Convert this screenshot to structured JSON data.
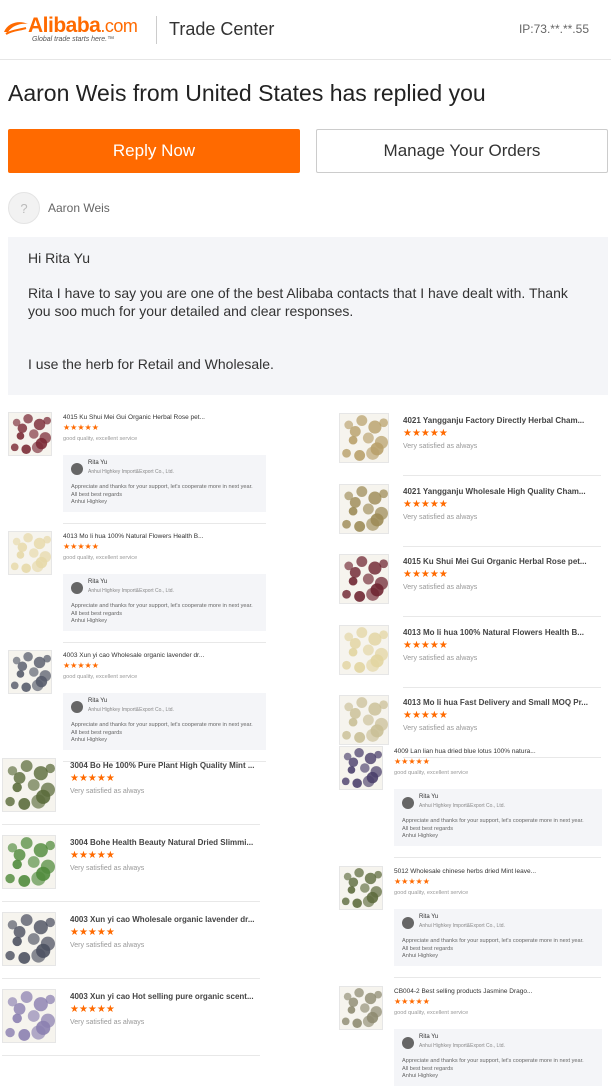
{
  "header": {
    "logo_word": "Alibaba",
    "logo_com": ".com",
    "logo_tagline": "Global trade starts here.™",
    "section_title": "Trade Center",
    "ip": "IP:73.**.**.55"
  },
  "headline": "Aaron Weis from United States has replied you",
  "buttons": {
    "reply": "Reply Now",
    "orders": "Manage Your Orders"
  },
  "sender": {
    "avatar_glyph": "?",
    "name": "Aaron Weis"
  },
  "message": {
    "greeting": "Hi Rita Yu",
    "para1": "Rita I have to say you are one of the best Alibaba contacts that I have dealt with. Thank you soo much for your detailed and clear responses.",
    "para2": "I use the herb for Retail and Wholesale."
  },
  "reply_common": {
    "name": "Rita Yu",
    "company": "Anhui Highkey Import&Export Co., Ltd.",
    "line1": "Appreciate and thanks for your support, let's cooperate more in next year.",
    "line2": "All best best regards",
    "line3": "Anhui Highkey"
  },
  "stars": "★★★★★",
  "left_items": [
    {
      "title": "4015 Ku Shui Mei Gui Organic Herbal Rose pet...",
      "comment": "good quality, excellent service",
      "color": "#7a2a35"
    },
    {
      "title": "4013 Mo li hua 100% Natural Flowers Health B...",
      "comment": "good quality, excellent service",
      "color": "#e6d9a8"
    },
    {
      "title": "4003 Xun yi cao Wholesale organic lavender dr...",
      "comment": "good quality, excellent service",
      "color": "#555a6a"
    },
    {
      "title": "3004 Bo He 100% Pure Plant High Quality Mint ...",
      "comment": "Very satisfied as always",
      "color": "#5a6b3a"
    },
    {
      "title": "3004 Bohe Health Beauty Natural Dried Slimmi...",
      "comment": "Very satisfied as always",
      "color": "#4f8a3a"
    },
    {
      "title": "4003 Xun yi cao Wholesale organic lavender dr...",
      "comment": "Very satisfied as always",
      "color": "#4b5060"
    },
    {
      "title": "4003 Xun yi cao Hot selling pure organic scent...",
      "comment": "Very satisfied as always",
      "color": "#8a7fb0"
    }
  ],
  "right_items": [
    {
      "title": "4021 Yangganju Factory Directly Herbal Cham...",
      "comment": "Very satisfied as always",
      "color": "#b8a06a"
    },
    {
      "title": "4021 Yangganju Wholesale High Quality Cham...",
      "comment": "Very satisfied as always",
      "color": "#9c8a55"
    },
    {
      "title": "4015 Ku Shui Mei Gui Organic Herbal Rose pet...",
      "comment": "Very satisfied as always",
      "color": "#6e2430"
    },
    {
      "title": "4013 Mo li hua 100% Natural Flowers Health B...",
      "comment": "Very satisfied as always",
      "color": "#e2d4a0"
    },
    {
      "title": "4013 Mo li hua Fast Delivery and Small MOQ Pr...",
      "comment": "Very satisfied as always",
      "color": "#c9bf95"
    },
    {
      "title": "4009 Lan lian hua dried blue lotus 100% natura...",
      "comment": "good quality, excellent service",
      "color": "#4a3f6b"
    },
    {
      "title": "5012 Wholesale chinese herbs dried Mint leave...",
      "comment": "good quality, excellent service",
      "color": "#5d6b3d"
    },
    {
      "title": "CB004-2 Best selling products Jasmine Drago...",
      "comment": "good quality, excellent service",
      "color": "#8d8a70"
    }
  ]
}
